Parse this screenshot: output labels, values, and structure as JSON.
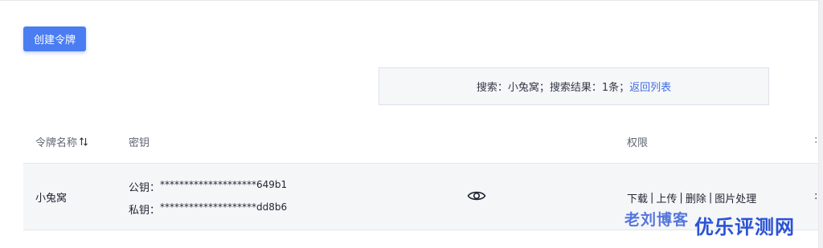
{
  "toolbar": {
    "create_label": "创建令牌"
  },
  "search": {
    "prefix": "搜索：小兔窝；搜索结果：1条；",
    "back_link": "返回列表"
  },
  "table": {
    "headers": {
      "name": "令牌名称",
      "key": "密钥",
      "perms": "权限"
    },
    "rows": [
      {
        "name": "小兔窝",
        "public_label": "公钥：",
        "public_key": "********************649b1",
        "private_label": "私钥：",
        "private_key": "********************dd8b6",
        "perms": [
          "下载",
          "上传",
          "删除",
          "图片处理"
        ]
      }
    ]
  },
  "watermarks": {
    "left": "老刘博客",
    "right": "优乐评测网"
  },
  "colors": {
    "accent": "#4a7df2",
    "link": "#3d6ee0"
  }
}
